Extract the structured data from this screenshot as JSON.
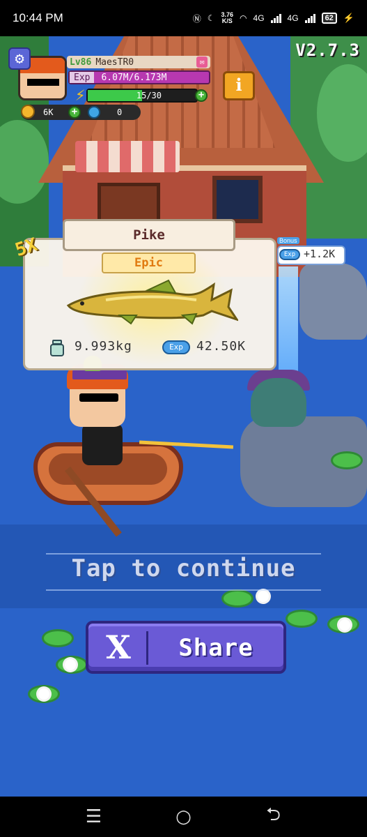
{
  "status_bar": {
    "time": "10:44 PM",
    "net_speed_value": "3.76",
    "net_speed_unit": "K/S",
    "network_1": "4G",
    "network_2": "4G",
    "battery": "62",
    "icons": [
      "nfc-icon",
      "moon-icon",
      "wifi-icon",
      "signal-icon",
      "battery-icon",
      "charging-icon"
    ]
  },
  "hud": {
    "version": "V2.7.3",
    "level": "Lv86",
    "player_name": "MaesTR0",
    "exp_label": "Exp",
    "exp_value": "6.07M/6.173M",
    "energy_value": "15/30",
    "energy_fraction": 0.5,
    "coins": "6K",
    "gems": "0",
    "info_label": "i"
  },
  "catch_card": {
    "multiplier": "5X",
    "fish_name": "Pike",
    "rarity": "Epic",
    "weight": "9.993kg",
    "exp_tag": "Exp",
    "exp_reward": "42.50K",
    "bonus_tag": "Bonus",
    "bonus_exp_tag": "Exp",
    "bonus_value": "+1.2K"
  },
  "prompt": {
    "tap_to_continue": "Tap to continue"
  },
  "share": {
    "icon_label": "X",
    "label": "Share"
  },
  "navbar": {
    "recents": "☰",
    "home": "○",
    "back": "⮌"
  },
  "colors": {
    "water": "#2a63c9",
    "share_button": "#6a5ad6",
    "rarity_text": "#e07a10",
    "exp_bar": "#b738b0",
    "energy_fill": "#3dc94a"
  }
}
